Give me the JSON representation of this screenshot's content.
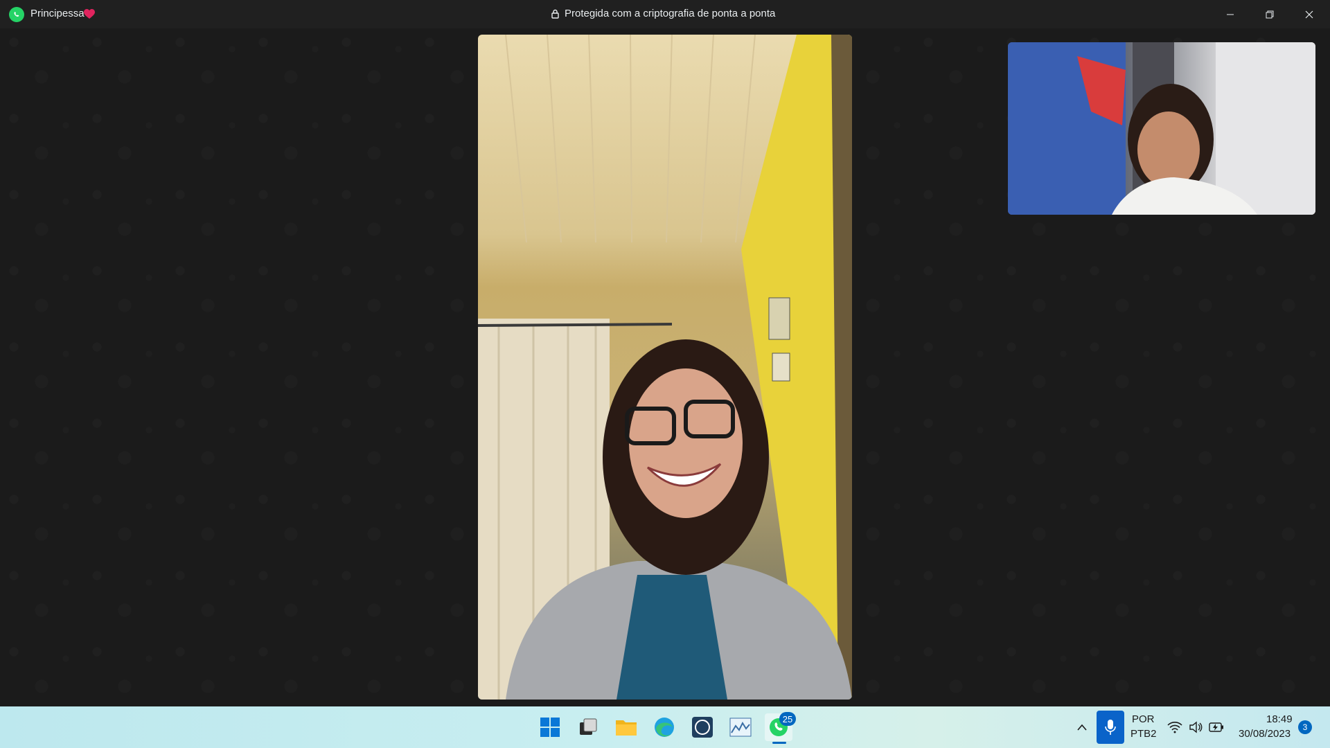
{
  "titlebar": {
    "contact_name": "Principessa",
    "encryption_text": "Protegida com a criptografia de ponta a ponta"
  },
  "call": {
    "main_video": "remote-participant",
    "pip_video": "local-preview"
  },
  "taskbar": {
    "whatsapp_badge": "25",
    "language_primary": "POR",
    "language_secondary": "PTB2",
    "time": "18:49",
    "date": "30/08/2023",
    "notification_count": "3"
  },
  "colors": {
    "whatsapp_green": "#25d366",
    "accent_blue": "#0067c0",
    "heart_red": "#e0245e"
  }
}
